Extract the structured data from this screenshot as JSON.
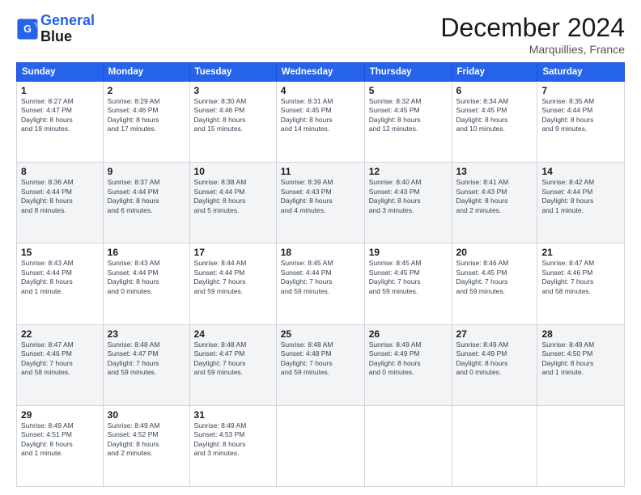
{
  "header": {
    "logo_line1": "General",
    "logo_line2": "Blue",
    "month": "December 2024",
    "location": "Marquillies, France"
  },
  "days_of_week": [
    "Sunday",
    "Monday",
    "Tuesday",
    "Wednesday",
    "Thursday",
    "Friday",
    "Saturday"
  ],
  "weeks": [
    [
      {
        "day": "1",
        "info": "Sunrise: 8:27 AM\nSunset: 4:47 PM\nDaylight: 8 hours\nand 19 minutes."
      },
      {
        "day": "2",
        "info": "Sunrise: 8:29 AM\nSunset: 4:46 PM\nDaylight: 8 hours\nand 17 minutes."
      },
      {
        "day": "3",
        "info": "Sunrise: 8:30 AM\nSunset: 4:46 PM\nDaylight: 8 hours\nand 15 minutes."
      },
      {
        "day": "4",
        "info": "Sunrise: 8:31 AM\nSunset: 4:45 PM\nDaylight: 8 hours\nand 14 minutes."
      },
      {
        "day": "5",
        "info": "Sunrise: 8:32 AM\nSunset: 4:45 PM\nDaylight: 8 hours\nand 12 minutes."
      },
      {
        "day": "6",
        "info": "Sunrise: 8:34 AM\nSunset: 4:45 PM\nDaylight: 8 hours\nand 10 minutes."
      },
      {
        "day": "7",
        "info": "Sunrise: 8:35 AM\nSunset: 4:44 PM\nDaylight: 8 hours\nand 9 minutes."
      }
    ],
    [
      {
        "day": "8",
        "info": "Sunrise: 8:36 AM\nSunset: 4:44 PM\nDaylight: 8 hours\nand 8 minutes."
      },
      {
        "day": "9",
        "info": "Sunrise: 8:37 AM\nSunset: 4:44 PM\nDaylight: 8 hours\nand 6 minutes."
      },
      {
        "day": "10",
        "info": "Sunrise: 8:38 AM\nSunset: 4:44 PM\nDaylight: 8 hours\nand 5 minutes."
      },
      {
        "day": "11",
        "info": "Sunrise: 8:39 AM\nSunset: 4:43 PM\nDaylight: 8 hours\nand 4 minutes."
      },
      {
        "day": "12",
        "info": "Sunrise: 8:40 AM\nSunset: 4:43 PM\nDaylight: 8 hours\nand 3 minutes."
      },
      {
        "day": "13",
        "info": "Sunrise: 8:41 AM\nSunset: 4:43 PM\nDaylight: 8 hours\nand 2 minutes."
      },
      {
        "day": "14",
        "info": "Sunrise: 8:42 AM\nSunset: 4:44 PM\nDaylight: 8 hours\nand 1 minute."
      }
    ],
    [
      {
        "day": "15",
        "info": "Sunrise: 8:43 AM\nSunset: 4:44 PM\nDaylight: 8 hours\nand 1 minute."
      },
      {
        "day": "16",
        "info": "Sunrise: 8:43 AM\nSunset: 4:44 PM\nDaylight: 8 hours\nand 0 minutes."
      },
      {
        "day": "17",
        "info": "Sunrise: 8:44 AM\nSunset: 4:44 PM\nDaylight: 7 hours\nand 59 minutes."
      },
      {
        "day": "18",
        "info": "Sunrise: 8:45 AM\nSunset: 4:44 PM\nDaylight: 7 hours\nand 59 minutes."
      },
      {
        "day": "19",
        "info": "Sunrise: 8:45 AM\nSunset: 4:45 PM\nDaylight: 7 hours\nand 59 minutes."
      },
      {
        "day": "20",
        "info": "Sunrise: 8:46 AM\nSunset: 4:45 PM\nDaylight: 7 hours\nand 59 minutes."
      },
      {
        "day": "21",
        "info": "Sunrise: 8:47 AM\nSunset: 4:46 PM\nDaylight: 7 hours\nand 58 minutes."
      }
    ],
    [
      {
        "day": "22",
        "info": "Sunrise: 8:47 AM\nSunset: 4:46 PM\nDaylight: 7 hours\nand 58 minutes."
      },
      {
        "day": "23",
        "info": "Sunrise: 8:48 AM\nSunset: 4:47 PM\nDaylight: 7 hours\nand 59 minutes."
      },
      {
        "day": "24",
        "info": "Sunrise: 8:48 AM\nSunset: 4:47 PM\nDaylight: 7 hours\nand 59 minutes."
      },
      {
        "day": "25",
        "info": "Sunrise: 8:48 AM\nSunset: 4:48 PM\nDaylight: 7 hours\nand 59 minutes."
      },
      {
        "day": "26",
        "info": "Sunrise: 8:49 AM\nSunset: 4:49 PM\nDaylight: 8 hours\nand 0 minutes."
      },
      {
        "day": "27",
        "info": "Sunrise: 8:49 AM\nSunset: 4:49 PM\nDaylight: 8 hours\nand 0 minutes."
      },
      {
        "day": "28",
        "info": "Sunrise: 8:49 AM\nSunset: 4:50 PM\nDaylight: 8 hours\nand 1 minute."
      }
    ],
    [
      {
        "day": "29",
        "info": "Sunrise: 8:49 AM\nSunset: 4:51 PM\nDaylight: 8 hours\nand 1 minute."
      },
      {
        "day": "30",
        "info": "Sunrise: 8:49 AM\nSunset: 4:52 PM\nDaylight: 8 hours\nand 2 minutes."
      },
      {
        "day": "31",
        "info": "Sunrise: 8:49 AM\nSunset: 4:53 PM\nDaylight: 8 hours\nand 3 minutes."
      },
      null,
      null,
      null,
      null
    ]
  ]
}
